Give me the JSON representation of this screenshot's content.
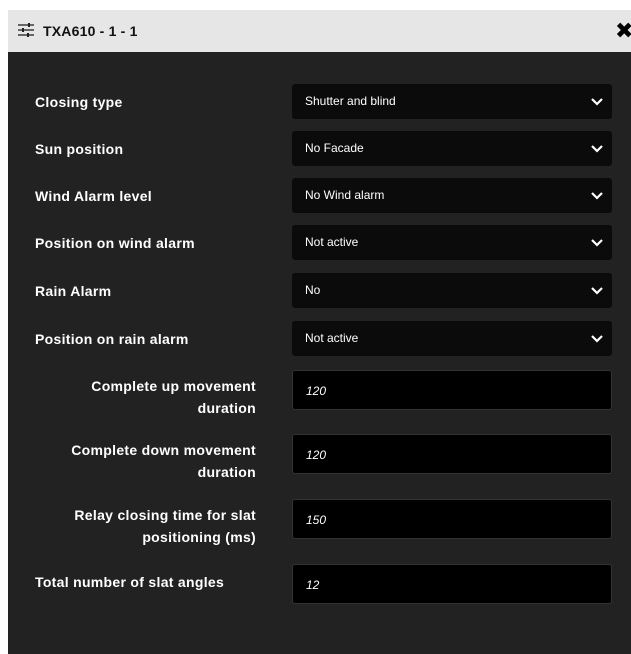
{
  "window": {
    "title": "TXA610 - 1 - 1"
  },
  "settings": [
    {
      "label": "Closing type",
      "type": "select",
      "value": "Shutter and blind"
    },
    {
      "label": "Sun position",
      "type": "select",
      "value": "No Facade"
    },
    {
      "label": "Wind Alarm level",
      "type": "select",
      "value": "No Wind alarm"
    },
    {
      "label": "Position on wind alarm",
      "type": "select",
      "value": "Not active"
    },
    {
      "label": "Rain Alarm",
      "type": "select",
      "value": "No"
    },
    {
      "label": "Position on rain alarm",
      "type": "select",
      "value": "Not active"
    },
    {
      "label_line1": "Complete up movement",
      "label_line2": "duration",
      "type": "input",
      "value": "120"
    },
    {
      "label_line1": "Complete down movement",
      "label_line2": "duration",
      "type": "input",
      "value": "120"
    },
    {
      "label_line1": "Relay closing time for slat",
      "label_line2": "positioning (ms)",
      "type": "input",
      "value": "150"
    },
    {
      "label": "Total number of slat angles",
      "type": "input",
      "value": "12"
    }
  ],
  "icons": {
    "title": "sliders-icon",
    "close": "close-icon",
    "dropdown": "chevron-down-icon"
  },
  "colors": {
    "panel_background": "#222222",
    "titlebar_background": "#e6e6e6",
    "control_background": "#0b0b0b",
    "text": "#ffffff"
  }
}
